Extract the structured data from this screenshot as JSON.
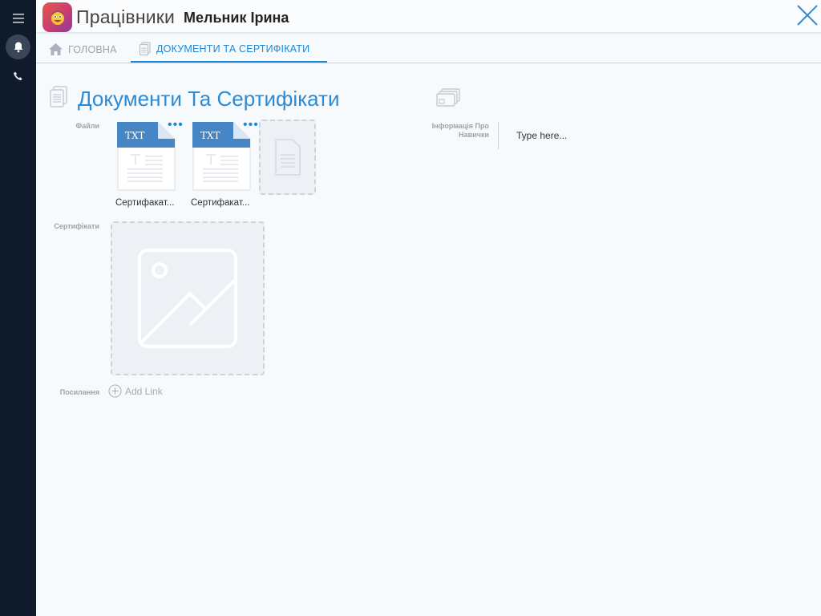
{
  "rail": {
    "icons": [
      "menu-icon",
      "bell-icon",
      "phone-icon"
    ]
  },
  "header": {
    "app_name": "Працівники",
    "record_name": "Мельник Ірина"
  },
  "tabs": [
    {
      "label": "ГОЛОВНА",
      "icon": "home-icon",
      "active": false
    },
    {
      "label": "ДОКУМЕНТИ ТА СЕРТИФІКАТИ",
      "icon": "document-icon",
      "active": true
    }
  ],
  "section": {
    "title": "Документи Та Сертифікати"
  },
  "fields": {
    "files_label": "Файли",
    "certs_label": "Сертифікати",
    "links_label": "Посилання",
    "skills_label": "Інформація Про Навички",
    "skills_placeholder": "Type here...",
    "add_link": "Add Link"
  },
  "files": [
    {
      "type": "TXT",
      "name": "Сертифакат..."
    },
    {
      "type": "TXT",
      "name": "Сертифакат..."
    }
  ],
  "colors": {
    "accent": "#1b88d8",
    "rail": "#0f1a2b",
    "file_header": "#4786c4"
  }
}
